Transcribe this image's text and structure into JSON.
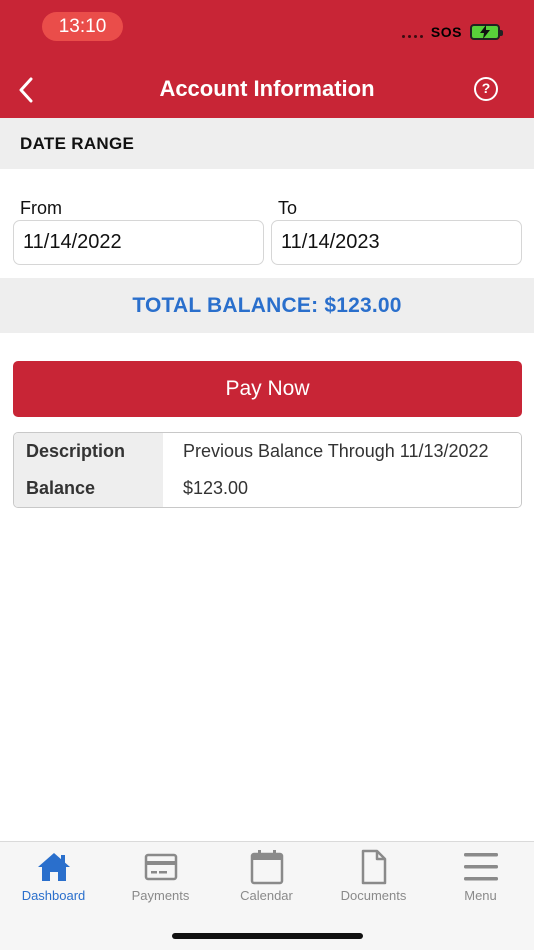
{
  "status_bar": {
    "time": "13:10",
    "carrier": "SOS"
  },
  "header": {
    "title": "Account Information",
    "help_glyph": "?"
  },
  "date_range": {
    "title": "DATE RANGE",
    "from_label": "From",
    "from_value": "11/14/2022",
    "to_label": "To",
    "to_value": "11/14/2023"
  },
  "total": {
    "text": "TOTAL BALANCE: $123.00"
  },
  "pay_button": {
    "label": "Pay Now"
  },
  "details": {
    "rows": [
      {
        "label": "Description",
        "value": "Previous Balance Through 11/13/2022"
      },
      {
        "label": "Balance",
        "value": "$123.00"
      }
    ]
  },
  "tabs": [
    {
      "label": "Dashboard",
      "icon": "home-icon",
      "active": true
    },
    {
      "label": "Payments",
      "icon": "credit-card-icon",
      "active": false
    },
    {
      "label": "Calendar",
      "icon": "calendar-icon",
      "active": false
    },
    {
      "label": "Documents",
      "icon": "document-icon",
      "active": false
    },
    {
      "label": "Menu",
      "icon": "hamburger-menu-icon",
      "active": false
    }
  ],
  "colors": {
    "brand_red": "#c82536",
    "accent_blue": "#2a6fcc",
    "tab_inactive": "#8a8a8a"
  }
}
